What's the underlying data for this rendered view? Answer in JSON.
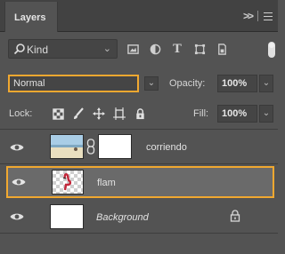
{
  "panel": {
    "tab_label": "Layers",
    "tab_overflow": ">>",
    "menu_icon": "hamburger-menu-icon"
  },
  "filter": {
    "kind_label": "Kind",
    "icons": [
      "image-filter-icon",
      "adjustment-filter-icon",
      "type-filter-icon",
      "shape-filter-icon",
      "smart-object-filter-icon"
    ]
  },
  "blend": {
    "mode": "Normal",
    "opacity_label": "Opacity:",
    "opacity_value": "100%"
  },
  "lock": {
    "label": "Lock:",
    "icons": [
      "lock-transparent-pixels-icon",
      "lock-image-pixels-icon",
      "lock-position-icon",
      "lock-artboard-icon",
      "lock-all-icon"
    ],
    "fill_label": "Fill:",
    "fill_value": "100%"
  },
  "layers": [
    {
      "name": "corriendo",
      "visible": true,
      "has_mask": true,
      "selected": false,
      "italic": false
    },
    {
      "name": "flam",
      "visible": true,
      "has_mask": false,
      "selected": true,
      "italic": false
    },
    {
      "name": "Background",
      "visible": true,
      "has_mask": false,
      "selected": false,
      "italic": true,
      "locked": true
    }
  ],
  "colors": {
    "panel_bg": "#535353",
    "highlight": "#f0a830",
    "selected_bg": "#6a6a6a"
  }
}
